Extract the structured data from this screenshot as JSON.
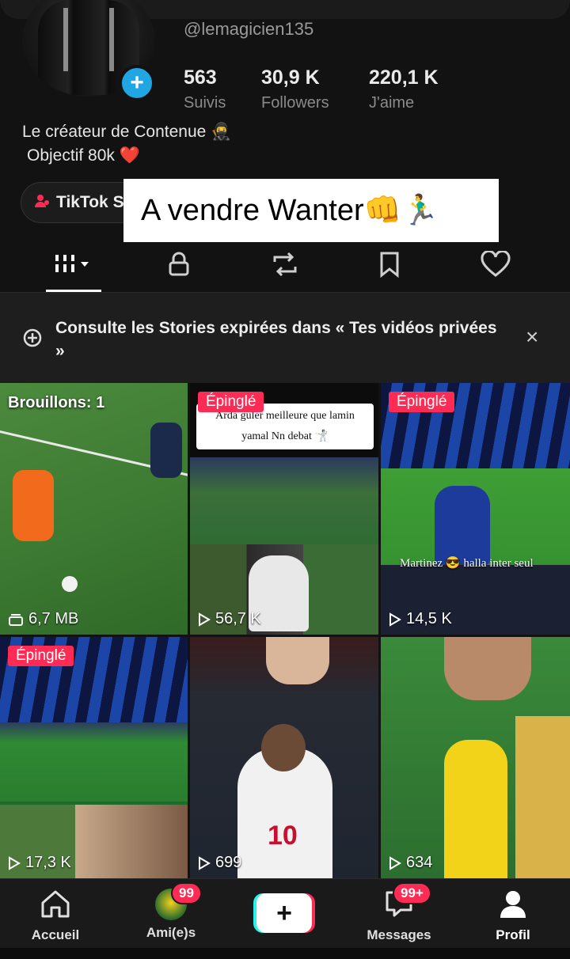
{
  "profile": {
    "handle": "@lemagicien135",
    "stats": [
      {
        "value": "563",
        "label": "Suivis"
      },
      {
        "value": "30,9 K",
        "label": "Followers"
      },
      {
        "value": "220,1 K",
        "label": "J'aime"
      }
    ],
    "bio_line1": "Le créateur de Contenue 🥷",
    "bio_line2": "Objectif 80k ❤️",
    "shop_pill": "TikTok S",
    "plus_symbol": "+"
  },
  "overlay": {
    "caption": "A vendre Wanter👊🏃‍♂️"
  },
  "notice": {
    "text": "Consulte les Stories expirées dans « Tes vidéos privées »",
    "close": "×"
  },
  "videos": [
    {
      "label": "Brouillons: 1",
      "meta": "6,7 MB",
      "type": "draft"
    },
    {
      "label": "Épinglé",
      "meta": "56,7 K",
      "caption": "Arda guler meilleure que lamin yamal Nn debat 🤺"
    },
    {
      "label": "Épinglé",
      "meta": "14,5 K",
      "caption": "Martinez 😎 halla inter seul"
    },
    {
      "label": "Épinglé",
      "meta": "17,3 K"
    },
    {
      "label": "",
      "meta": "699"
    },
    {
      "label": "",
      "meta": "634"
    }
  ],
  "nav": {
    "home": "Accueil",
    "friends": "Ami(e)s",
    "friends_badge": "99",
    "create": "+",
    "messages": "Messages",
    "messages_badge": "99+",
    "profile": "Profil"
  },
  "colors": {
    "accent": "#fe2c55",
    "cyan": "#25f4ee",
    "follow_blue": "#1fa6e3",
    "background": "#121212"
  }
}
